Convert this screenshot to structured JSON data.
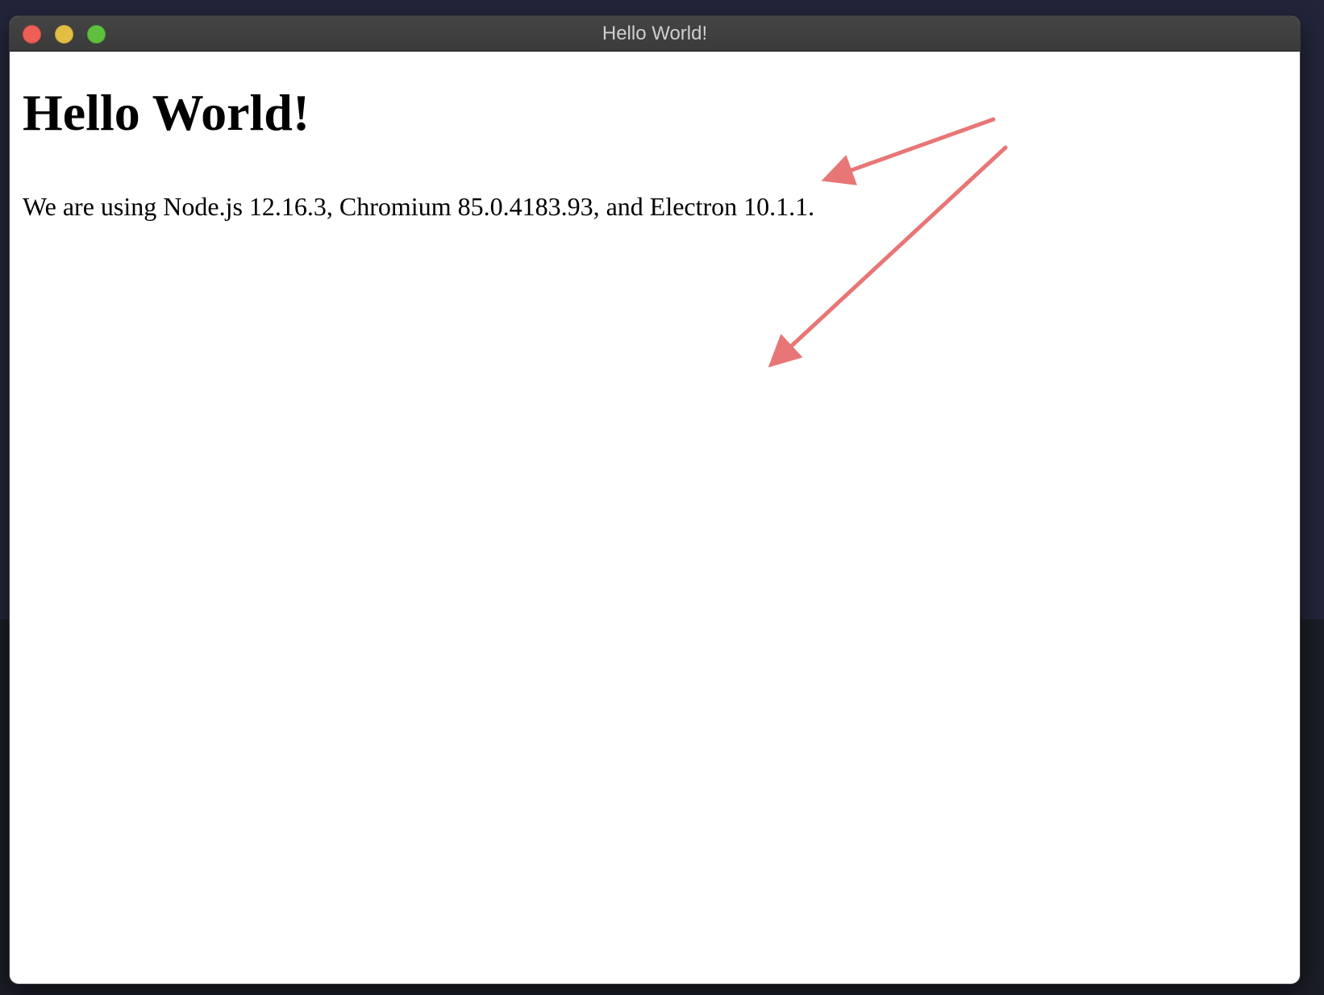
{
  "window": {
    "title": "Hello World!"
  },
  "page": {
    "heading": "Hello World!",
    "versions_line": "We are using Node.js 12.16.3, Chromium 85.0.4183.93, and Electron 10.1.1."
  },
  "colors": {
    "annotation_arrow": "#e87676",
    "titlebar": "#3f3f3f",
    "close": "#ee5f57",
    "minimize": "#e2be45",
    "zoom": "#5fc03f"
  }
}
